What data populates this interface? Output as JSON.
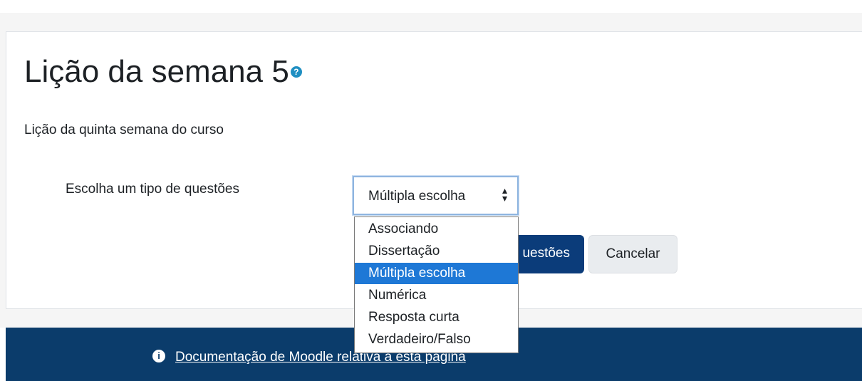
{
  "page": {
    "title": "Lição da semana 5",
    "help_icon": "question-circle-icon",
    "description": "Lição da quinta semana do curso"
  },
  "form": {
    "question_type_label": "Escolha um tipo de questões",
    "select_value": "Múltipla escolha",
    "select_arrow": "⬍",
    "options": [
      "Associando",
      "Dissertação",
      "Múltipla escolha",
      "Numérica",
      "Resposta curta",
      "Verdadeiro/Falso"
    ],
    "selected_option": "Múltipla escolha",
    "add_button_label": "Adicionar uma questões",
    "add_button_visible_fragment": "uestões",
    "cancel_button_label": "Cancelar"
  },
  "footer": {
    "info_icon": "info-circle-icon",
    "doc_link": "Documentação de Moodle relativa a esta página"
  },
  "colors": {
    "footer_bg": "#0b3c6b",
    "primary_button": "#0b3c7a",
    "selected_option_bg": "#1e78d6",
    "help_icon": "#1f8fc2"
  }
}
